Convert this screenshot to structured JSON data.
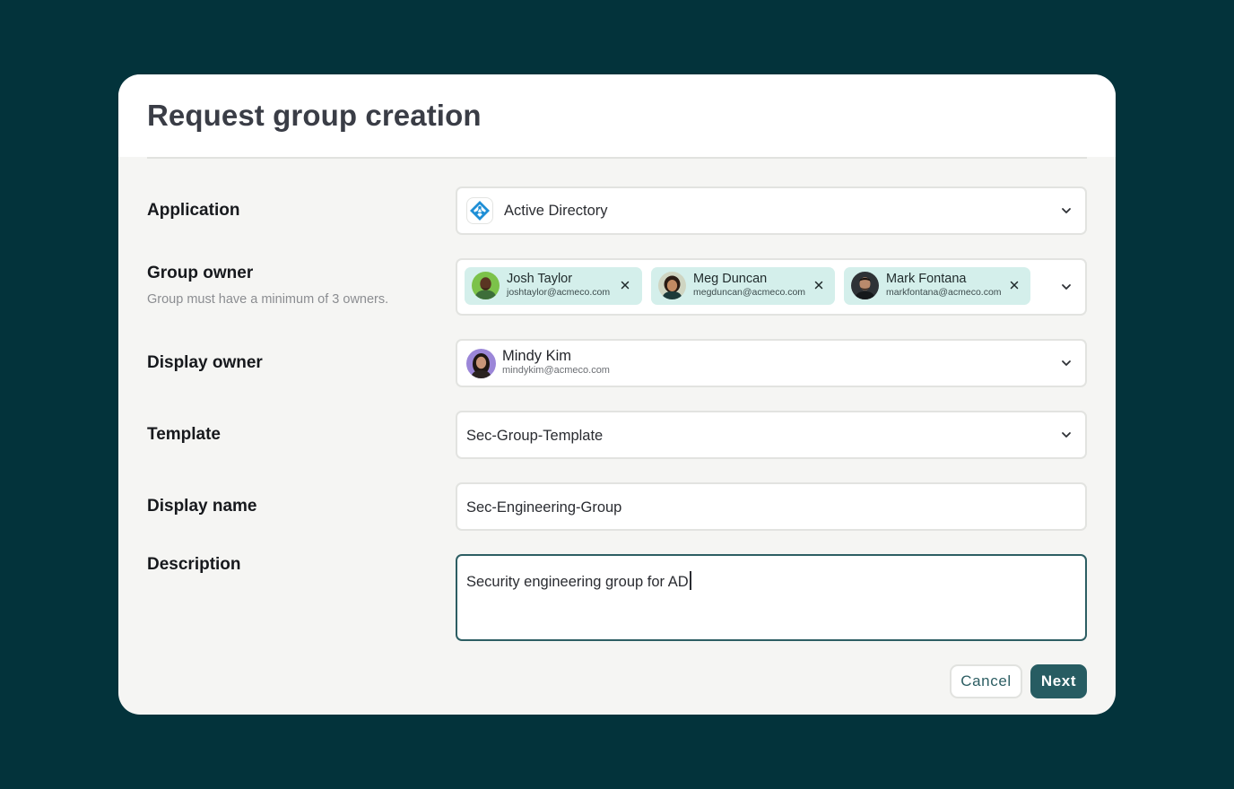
{
  "dialog": {
    "title": "Request group creation"
  },
  "application": {
    "label": "Application",
    "value": "Active Directory",
    "icon": "active-directory-icon",
    "icon_color": "#1f8fd6"
  },
  "group_owner": {
    "label": "Group owner",
    "hint": "Group must have a minimum of 3 owners.",
    "owners": [
      {
        "name": "Josh Taylor",
        "email": "joshtaylor@acmeco.com"
      },
      {
        "name": "Meg Duncan",
        "email": "megduncan@acmeco.com"
      },
      {
        "name": "Mark Fontana",
        "email": "markfontana@acmeco.com"
      }
    ]
  },
  "display_owner": {
    "label": "Display owner",
    "name": "Mindy Kim",
    "email": "mindykim@acmeco.com"
  },
  "template": {
    "label": "Template",
    "value": "Sec-Group-Template"
  },
  "display_name": {
    "label": "Display name",
    "value": "Sec-Engineering-Group"
  },
  "description": {
    "label": "Description",
    "value": "Security engineering group for AD"
  },
  "actions": {
    "cancel": "Cancel",
    "next": "Next"
  },
  "colors": {
    "backdrop": "#03333b",
    "accent": "#275c62",
    "chip": "#d4efeb",
    "panel": "#f5f5f3"
  }
}
